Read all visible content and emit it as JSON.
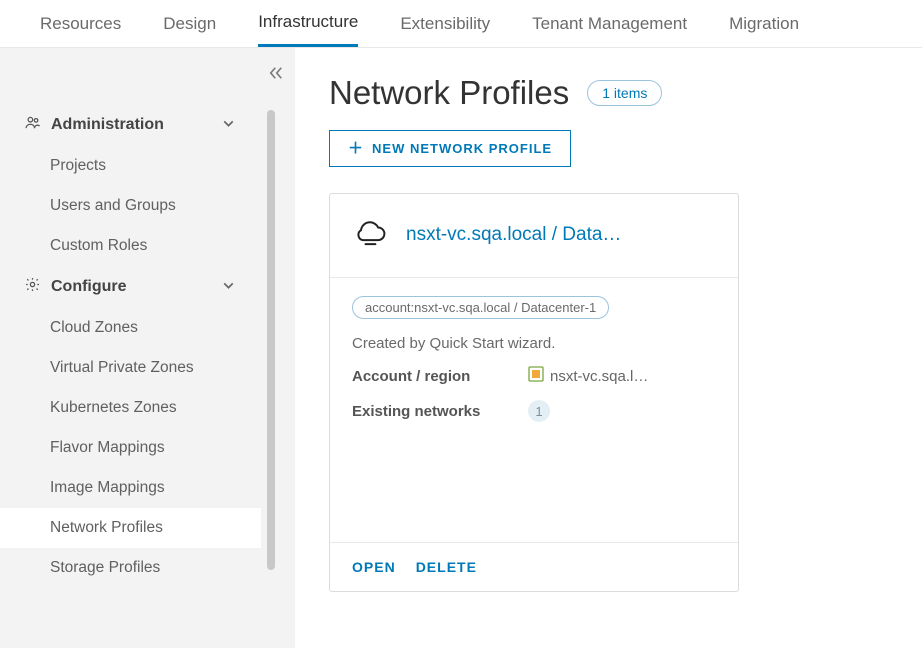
{
  "topbar": {
    "tabs": [
      {
        "label": "Resources"
      },
      {
        "label": "Design"
      },
      {
        "label": "Infrastructure",
        "active": true
      },
      {
        "label": "Extensibility"
      },
      {
        "label": "Tenant Management"
      },
      {
        "label": "Migration"
      }
    ]
  },
  "sidebar": {
    "sections": [
      {
        "icon": "users-icon",
        "label": "Administration",
        "items": [
          {
            "label": "Projects"
          },
          {
            "label": "Users and Groups"
          },
          {
            "label": "Custom Roles"
          }
        ]
      },
      {
        "icon": "gear-icon",
        "label": "Configure",
        "items": [
          {
            "label": "Cloud Zones"
          },
          {
            "label": "Virtual Private Zones"
          },
          {
            "label": "Kubernetes Zones"
          },
          {
            "label": "Flavor Mappings"
          },
          {
            "label": "Image Mappings"
          },
          {
            "label": "Network Profiles",
            "selected": true
          },
          {
            "label": "Storage Profiles"
          }
        ]
      }
    ]
  },
  "page": {
    "title": "Network Profiles",
    "items_badge": "1 items",
    "new_button": "NEW NETWORK PROFILE"
  },
  "card": {
    "title": "nsxt-vc.sqa.local / Data…",
    "tag": "account:nsxt-vc.sqa.local / Datacenter-1",
    "description": "Created by Quick Start wizard.",
    "account_region_label": "Account / region",
    "account_region_value": "nsxt-vc.sqa.l…",
    "existing_networks_label": "Existing networks",
    "existing_networks_count": "1",
    "open_label": "OPEN",
    "delete_label": "DELETE"
  }
}
